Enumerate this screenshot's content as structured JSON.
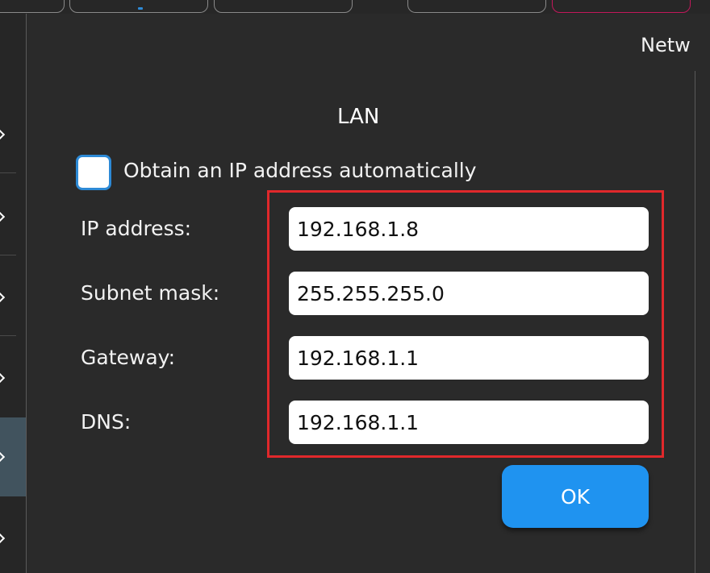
{
  "header": {
    "title_fragment": "Netw"
  },
  "dialog": {
    "title": "LAN",
    "auto_ip": {
      "label": "Obtain an IP address automatically",
      "checked": false
    },
    "fields": [
      {
        "label": "IP address:",
        "value": "192.168.1.8"
      },
      {
        "label": "Subnet mask:",
        "value": "255.255.255.0"
      },
      {
        "label": "Gateway:",
        "value": "192.168.1.1"
      },
      {
        "label": "DNS:",
        "value": "192.168.1.1"
      }
    ],
    "ok_label": "OK"
  },
  "colors": {
    "background": "#2a2a2a",
    "accent": "#1f93f0",
    "checkbox_border": "#2d8ad6",
    "highlight": "#e0282b",
    "sidebar_active": "#41535e"
  },
  "icons": {
    "sidebar_arrow": "chevron-right-icon"
  }
}
